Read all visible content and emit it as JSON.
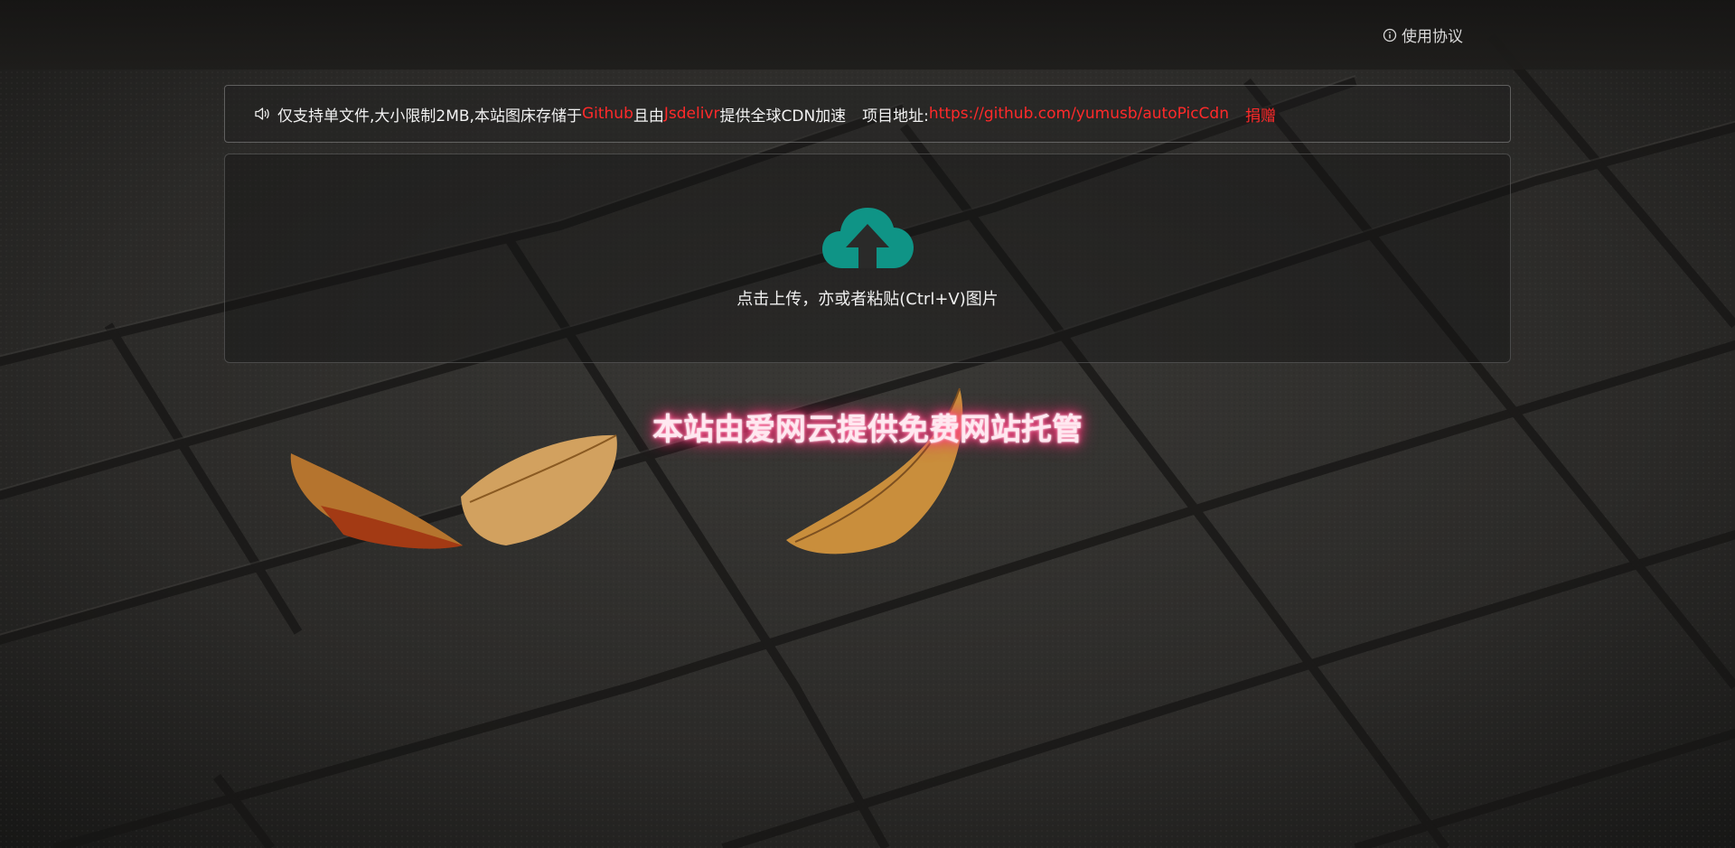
{
  "topbar": {
    "agreement_icon": "info-circle-icon",
    "agreement_label": "使用协议"
  },
  "notice": {
    "icon": "speaker-icon",
    "segments": {
      "s1": "仅支持单文件,大小限制2MB,本站图床存储于",
      "github": "Github",
      "s2": "且由",
      "jsdelivr": "Jsdelivr",
      "s3": "提供全球CDN加速",
      "project_label": "项目地址:",
      "project_url": "https://github.com/yumusb/autoPicCdn",
      "donate": "捐赠"
    },
    "highlight_color": "#ff2a2a"
  },
  "upload": {
    "icon": "cloud-upload-icon",
    "icon_color": "#0f9486",
    "text": "点击上传，亦或者粘贴(Ctrl+V)图片"
  },
  "hosting_note": "本站由爱网云提供免费网站托管"
}
